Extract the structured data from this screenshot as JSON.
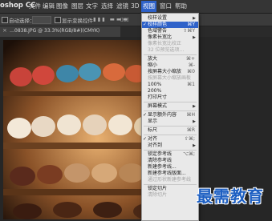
{
  "app": {
    "name": "oshop CC"
  },
  "menubar": {
    "items": [
      {
        "label": "文件"
      },
      {
        "label": "编辑"
      },
      {
        "label": "图像"
      },
      {
        "label": "图层"
      },
      {
        "label": "文字"
      },
      {
        "label": "选择"
      },
      {
        "label": "滤镜"
      },
      {
        "label": "3D"
      },
      {
        "label": "视图",
        "active": true
      },
      {
        "label": "窗口"
      },
      {
        "label": "帮助"
      }
    ]
  },
  "options": {
    "auto_select_label": "自动选择：",
    "show_transform_label": "显示变换控件"
  },
  "document": {
    "tab_label": "…0838.JPG @ 33.3%(RGB/8#)(CMYK)"
  },
  "view_menu": {
    "items": [
      {
        "label": "校样设置",
        "arrow": true
      },
      {
        "label": "校样颜色",
        "shortcut": "⌘Y",
        "checked": true,
        "highlighted": true
      },
      {
        "label": "色域警告",
        "shortcut": "⇧⌘Y"
      },
      {
        "label": "像素长宽比",
        "arrow": true
      },
      {
        "label": "像素长宽比校正",
        "disabled": true
      },
      {
        "label": "32 位预览选项...",
        "disabled": true
      },
      {
        "sep": true
      },
      {
        "label": "放大",
        "shortcut": "⌘+"
      },
      {
        "label": "缩小",
        "shortcut": "⌘-"
      },
      {
        "label": "按屏幕大小缩放",
        "shortcut": "⌘0"
      },
      {
        "label": "按屏幕大小缩放画板",
        "disabled": true
      },
      {
        "label": "100%",
        "shortcut": "⌘1"
      },
      {
        "label": "200%"
      },
      {
        "label": "打印尺寸"
      },
      {
        "sep": true
      },
      {
        "label": "屏幕模式",
        "arrow": true
      },
      {
        "sep": true
      },
      {
        "label": "显示额外内容",
        "shortcut": "⌘H",
        "checked": true
      },
      {
        "label": "显示",
        "arrow": true
      },
      {
        "sep": true
      },
      {
        "label": "标尺",
        "shortcut": "⌘R"
      },
      {
        "sep": true
      },
      {
        "label": "对齐",
        "shortcut": "⇧⌘;",
        "checked": true
      },
      {
        "label": "对齐到",
        "arrow": true
      },
      {
        "sep": true
      },
      {
        "label": "锁定参考线",
        "shortcut": "⌥⌘;"
      },
      {
        "label": "清除参考线"
      },
      {
        "label": "新建参考线..."
      },
      {
        "label": "新建参考线版面..."
      },
      {
        "label": "通过形状新建参考线",
        "disabled": true
      },
      {
        "sep": true
      },
      {
        "label": "锁定切片"
      },
      {
        "label": "清除切片",
        "disabled": true
      }
    ]
  },
  "watermark": {
    "text": "最需教育"
  },
  "colors": {
    "accent": "#2f62c9",
    "watermark": "#1d5fc2"
  }
}
